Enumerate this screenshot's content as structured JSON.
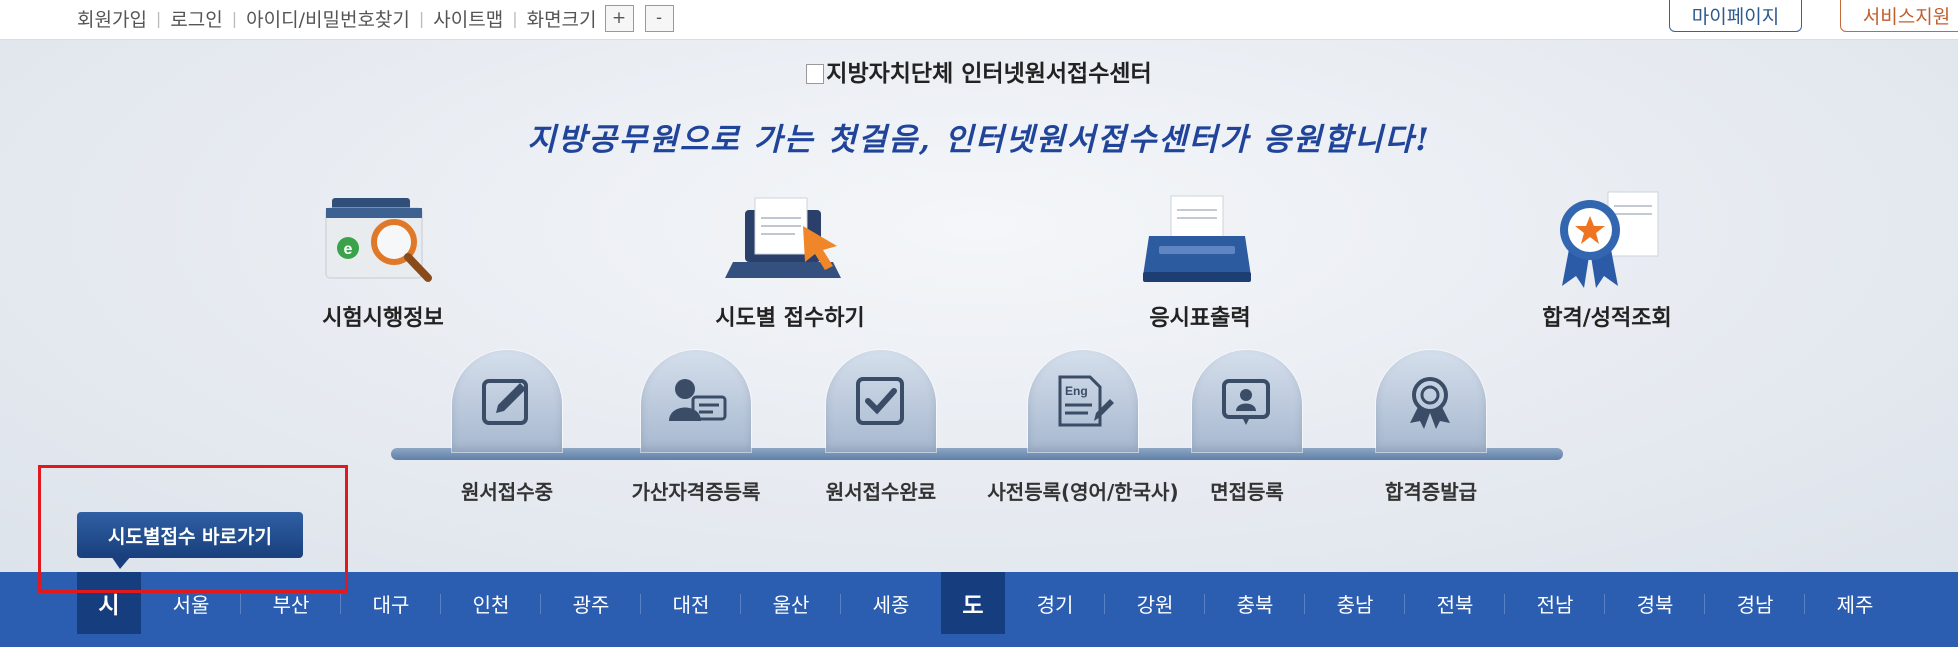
{
  "topbar": {
    "links": [
      "회원가입",
      "로그인",
      "아이디/비밀번호찾기",
      "사이트맵",
      "화면크기"
    ],
    "zoom_in": "+",
    "zoom_out": "-",
    "mypage": "마이페이지",
    "support": "서비스지원"
  },
  "logo_alt": "지방자치단체 인터넷원서접수센터",
  "slogan": "지방공무원으로 가는 첫걸음, 인터넷원서접수센터가 응원합니다!",
  "features": [
    {
      "label": "시험시행정보",
      "icon": "folder-magnifier-icon"
    },
    {
      "label": "시도별 접수하기",
      "icon": "laptop-cursor-icon"
    },
    {
      "label": "응시표출력",
      "icon": "printer-icon"
    },
    {
      "label": "합격/성적조회",
      "icon": "award-ribbon-icon"
    }
  ],
  "steps": [
    {
      "label": "원서접수중",
      "icon": "pencil-icon"
    },
    {
      "label": "가산자격증등록",
      "icon": "id-card-icon"
    },
    {
      "label": "원서접수완료",
      "icon": "checkbox-icon"
    },
    {
      "label": "사전등록(영어/한국사)",
      "icon": "eng-document-icon"
    },
    {
      "label": "면접등록",
      "icon": "person-badge-icon"
    },
    {
      "label": "합격증발급",
      "icon": "rosette-icon"
    }
  ],
  "shortcut": "시도별접수 바로가기",
  "regions": {
    "si_label": "시",
    "si": [
      "서울",
      "부산",
      "대구",
      "인천",
      "광주",
      "대전",
      "울산",
      "세종"
    ],
    "do_label": "도",
    "do": [
      "경기",
      "강원",
      "충북",
      "충남",
      "전북",
      "전남",
      "경북",
      "경남",
      "제주"
    ]
  },
  "colors": {
    "region_bar": "#2b5db1",
    "region_header": "#163d7e",
    "slogan": "#20449a",
    "highlight": "#e0191f",
    "support_button": "#c15e2e",
    "mypage_button": "#2d5a8e"
  }
}
